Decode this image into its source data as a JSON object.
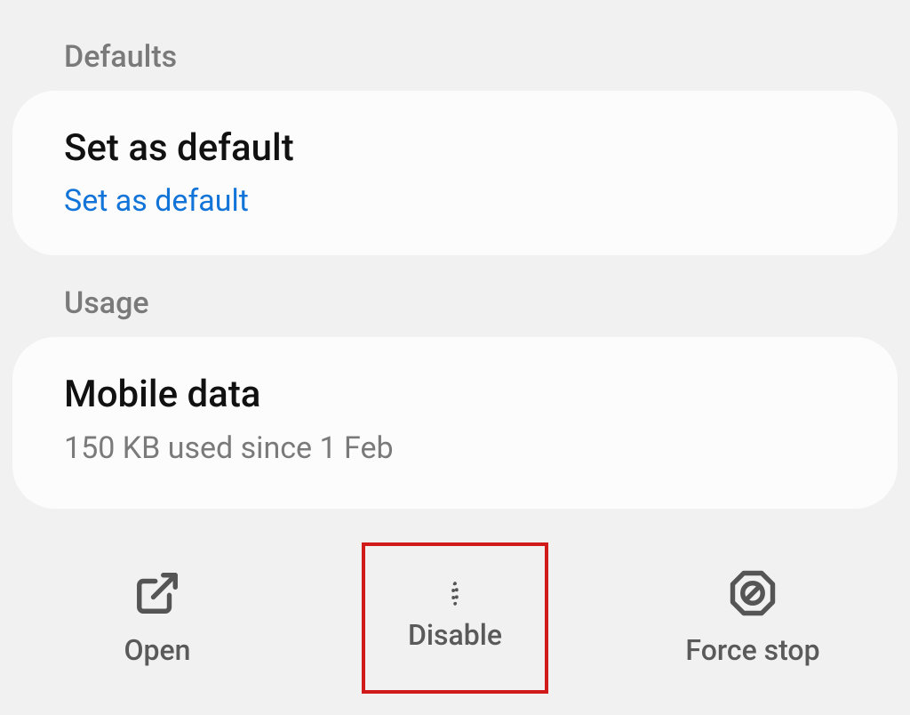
{
  "sections": {
    "defaults_header": "Defaults",
    "usage_header": "Usage"
  },
  "defaults_card": {
    "title": "Set as default",
    "subtitle": "Set as default"
  },
  "usage_card": {
    "title": "Mobile data",
    "subtitle": "150 KB used since 1 Feb"
  },
  "actions": {
    "open": "Open",
    "disable": "Disable",
    "force_stop": "Force stop"
  }
}
